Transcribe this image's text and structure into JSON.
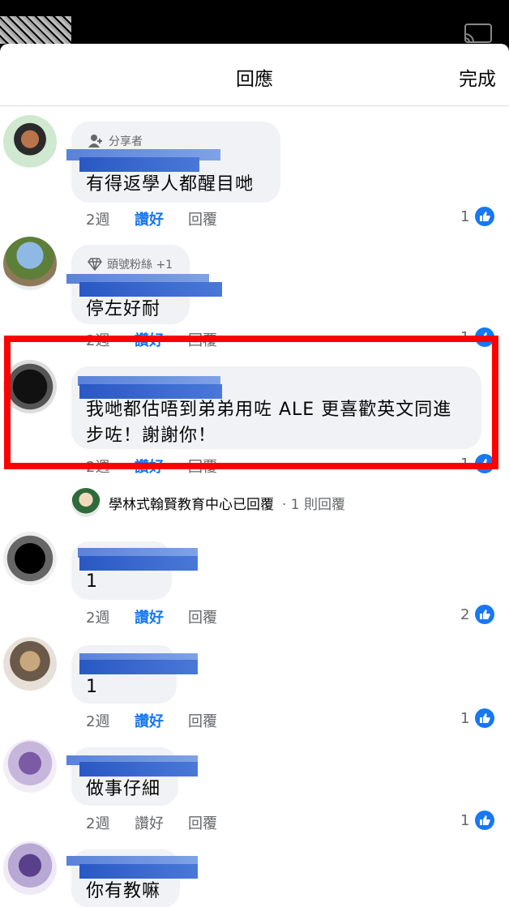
{
  "header": {
    "title": "回應",
    "done_label": "完成"
  },
  "comments": [
    {
      "badge": "分享者",
      "text": "有得返學人都醒目哋",
      "time": "2週",
      "like_label": "讚好",
      "reply_label": "回覆",
      "like_count": "1"
    },
    {
      "badge": "頭號粉絲 +1",
      "text": "停左好耐",
      "time": "2週",
      "like_label": "讚好",
      "reply_label": "回覆",
      "like_count": "1"
    },
    {
      "text_line1": "我哋都估唔到弟弟用咗 ALE 更喜歡英文同進",
      "text_line2": "步咗！謝謝你！",
      "time": "2週",
      "like_label": "讚好",
      "reply_label": "回覆",
      "like_count": "1"
    },
    {
      "text": "1",
      "time": "2週",
      "like_label": "讚好",
      "reply_label": "回覆",
      "like_count": "2"
    },
    {
      "text": "1",
      "time": "2週",
      "like_label": "讚好",
      "reply_label": "回覆",
      "like_count": "1"
    },
    {
      "text": "做事仔細",
      "time": "2週",
      "like_label": "讚好",
      "reply_label": "回覆",
      "like_count": "1"
    },
    {
      "text": "你有教嘛"
    }
  ],
  "reply_summary": {
    "author_text": "學林式翰賢教育中心已回覆",
    "count_text": "· 1 則回覆"
  },
  "colors": {
    "accent": "#1877f2",
    "highlight": "#ff0000",
    "bubble": "#f0f2f5"
  }
}
